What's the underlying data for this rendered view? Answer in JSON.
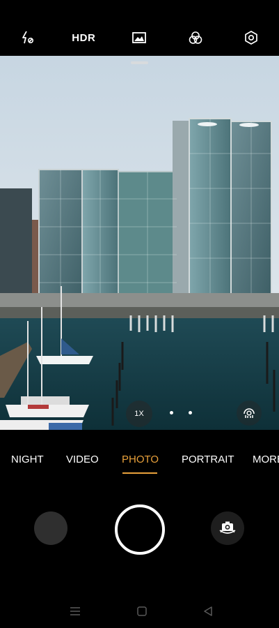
{
  "topbar": {
    "flash_icon": "flash-off-icon",
    "hdr_label": "HDR",
    "gallery_icon": "image-icon",
    "filters_icon": "filters-icon",
    "settings_icon": "settings-icon"
  },
  "viewfinder": {
    "zoom_label": "1X",
    "lens_icon": "portrait-lens-icon"
  },
  "modes": [
    {
      "label": "NIGHT",
      "active": false
    },
    {
      "label": "VIDEO",
      "active": false
    },
    {
      "label": "PHOTO",
      "active": true
    },
    {
      "label": "PORTRAIT",
      "active": false
    },
    {
      "label": "MORE",
      "active": false
    }
  ],
  "controls": {
    "gallery_thumb_icon": "gallery-thumbnail",
    "shutter_icon": "shutter-button",
    "flip_icon": "camera-flip-icon"
  },
  "navbar": {
    "menu_icon": "menu-icon",
    "home_icon": "home-icon",
    "back_icon": "back-icon"
  },
  "colors": {
    "accent": "#e9a13b",
    "background": "#000000"
  }
}
